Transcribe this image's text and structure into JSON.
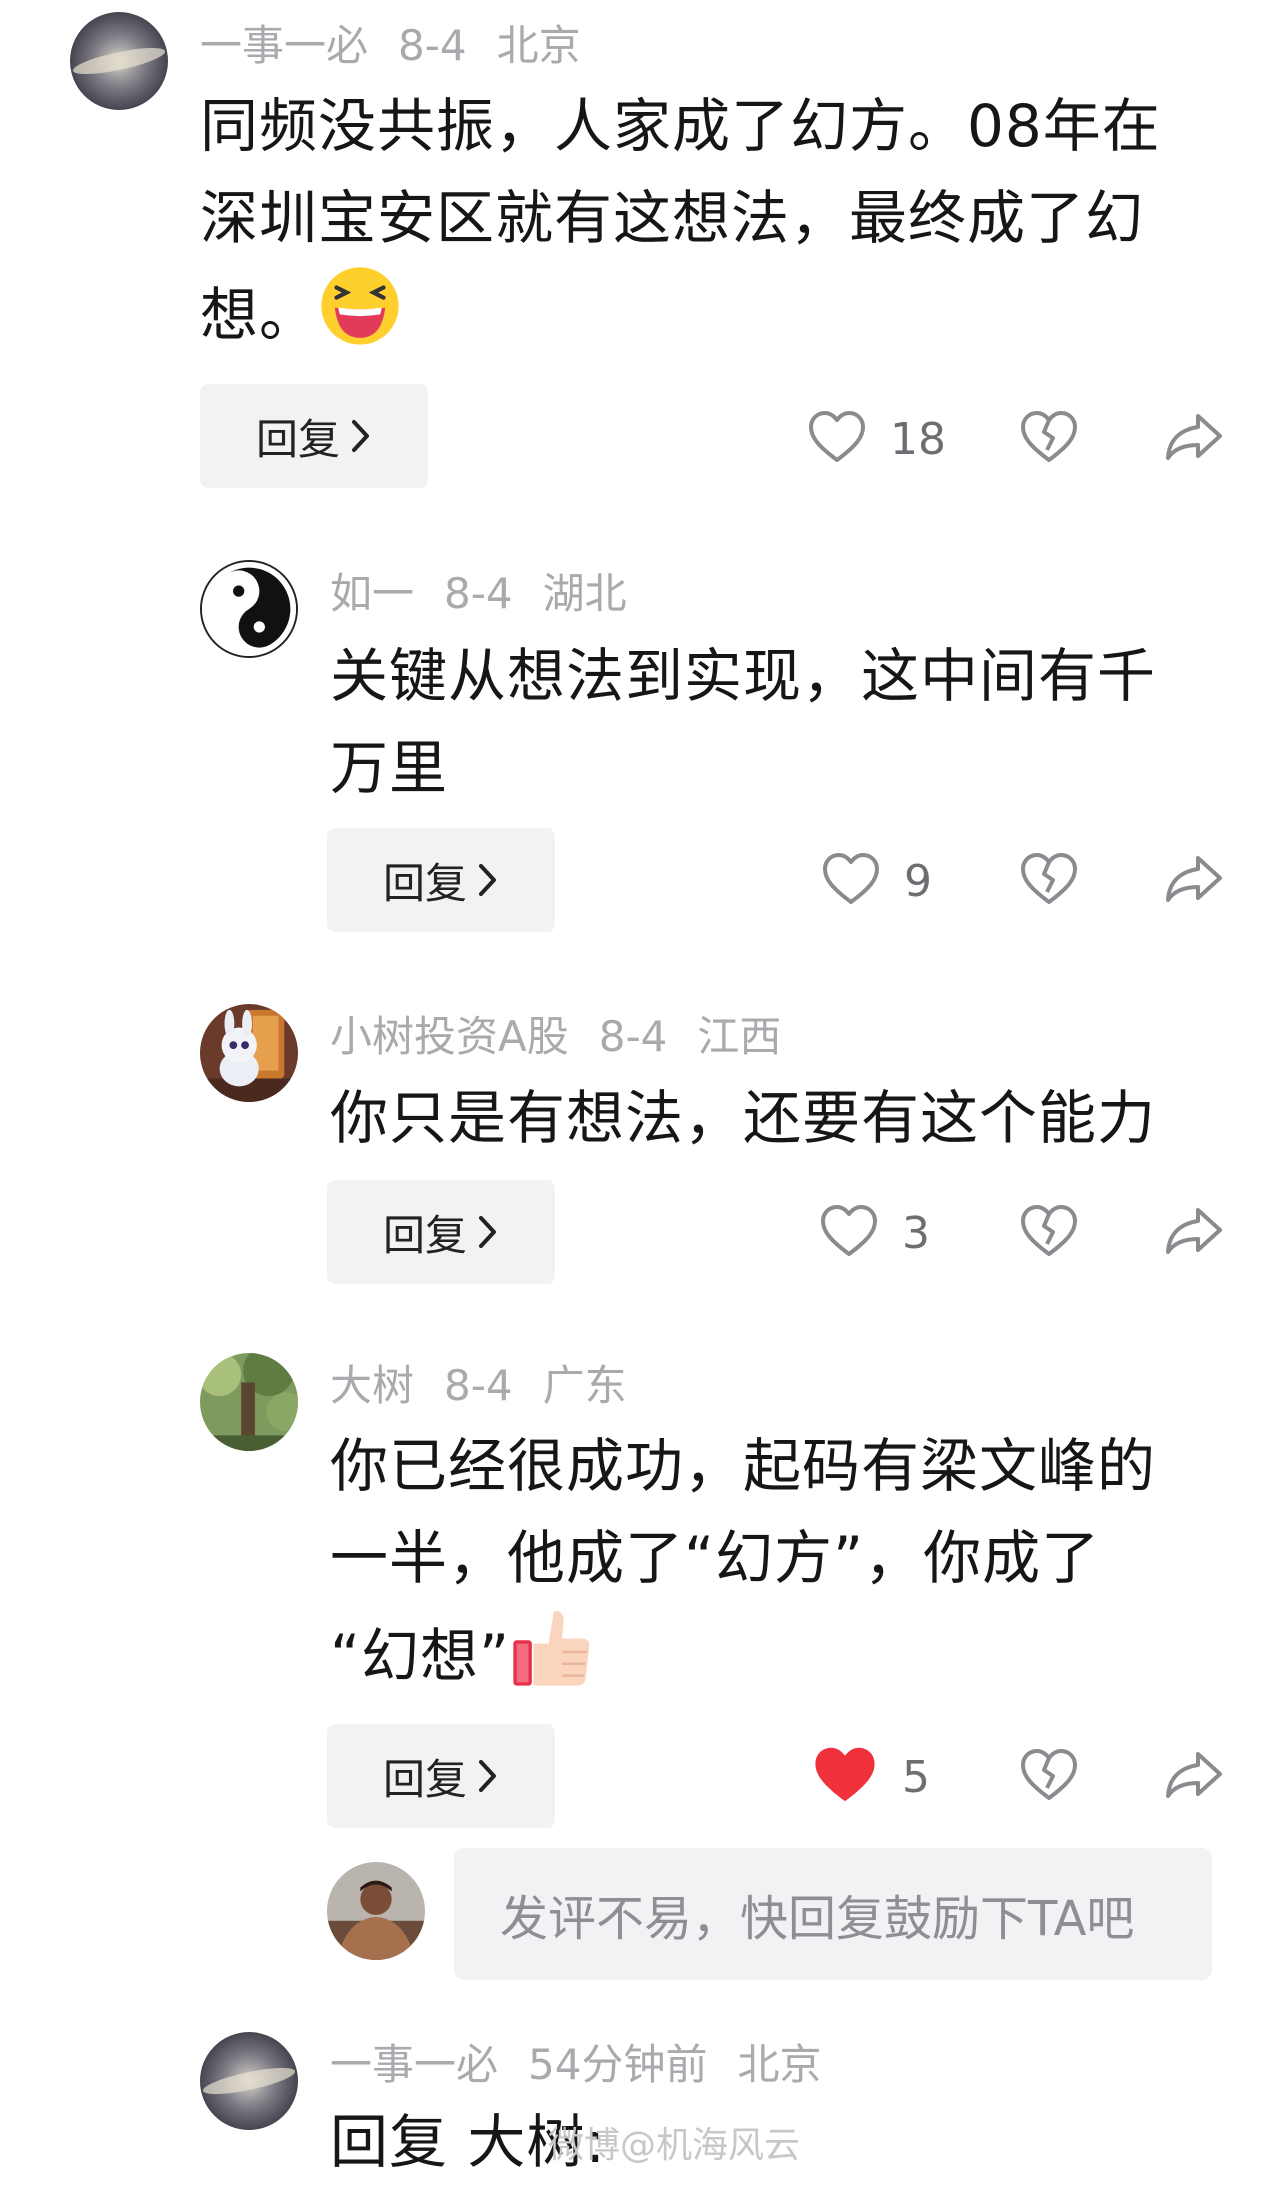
{
  "comments": [
    {
      "username": "一事一必",
      "date": "8-4",
      "location": "北京",
      "text_lines": [
        "同频没共振，人家成了幻方。08年在",
        "深圳宝安区就有这想法，最终成了幻",
        "想。"
      ],
      "reply_label": "回复",
      "likes": "18",
      "liked": false,
      "emoji": "laughing-face"
    },
    {
      "username": "如一",
      "date": "8-4",
      "location": "湖北",
      "text_lines": [
        "关键从想法到实现，这中间有千",
        "万里"
      ],
      "reply_label": "回复",
      "likes": "9",
      "liked": false
    },
    {
      "username": "小树投资A股",
      "date": "8-4",
      "location": "江西",
      "text_lines": [
        "你只是有想法，还要有这个能力"
      ],
      "reply_label": "回复",
      "likes": "3",
      "liked": false
    },
    {
      "username": "大树",
      "date": "8-4",
      "location": "广东",
      "text_lines": [
        "你已经很成功，起码有梁文峰的",
        "一半，他成了“幻方”，你成了",
        "“幻想”"
      ],
      "reply_label": "回复",
      "likes": "5",
      "liked": true,
      "emoji": "thumbs-up"
    }
  ],
  "reply_prompt": {
    "placeholder": "发评不易，快回复鼓励下TA吧"
  },
  "last_comment": {
    "username": "一事一必",
    "time": "54分钟前",
    "location": "北京",
    "text": "回复 大树:"
  },
  "watermark": "微博@机海风云",
  "colors": {
    "meta_gray": "#a9a9ae",
    "button_bg": "#f2f2f4",
    "liked_red": "#f0313c",
    "icon_gray": "#8a8a8f"
  },
  "icons": [
    "heart-icon",
    "dislike-icon",
    "share-icon",
    "chevron-right-icon"
  ]
}
